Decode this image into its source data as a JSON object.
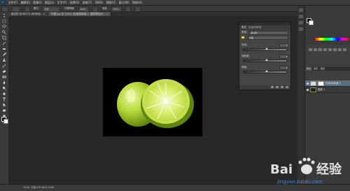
{
  "app": {
    "logo": "Ps"
  },
  "menubar": {
    "items": [
      "文件(F)",
      "编辑(E)",
      "图像(I)",
      "图层(L)",
      "文字(Y)",
      "选择(S)",
      "滤镜(T)",
      "3D(D)",
      "视图(V)",
      "窗口(W)",
      "帮助(H)"
    ]
  },
  "options": {
    "mode_label": "模式:",
    "mode_value": "正常",
    "opacity_label": "不透明度:",
    "opacity_value": "100%",
    "flow_label": "流量:",
    "flow_value": "100%"
  },
  "tabs": [
    {
      "label": "新文件 @ 66.7% (RGB/8)",
      "close": "×"
    },
    {
      "label": "柠檬.jpg @ 100% (色相/饱和度 1, 图层蒙版/8)",
      "close": "×"
    }
  ],
  "properties": {
    "title": "属性",
    "panel_name": "色相/饱和度",
    "preset_label": "预设:",
    "preset_value": "默认值",
    "channel_label": "",
    "channel_value": "全图",
    "hue_label": "色相:",
    "hue_value": "0",
    "saturation_label": "饱和度:",
    "saturation_value": "0",
    "lightness_label": "明度:",
    "lightness_value": "0"
  },
  "layers": {
    "tabs": [
      "图层",
      "通道",
      "路径"
    ],
    "items": [
      {
        "name": "色相/饱和度 1"
      },
      {
        "name": "图层 1"
      }
    ]
  },
  "statusbar": {
    "text": "100% 文档:291.8K/1.32M"
  },
  "watermark": {
    "brand": "Baidu 经验",
    "url": "jingyan.baidu.com"
  }
}
